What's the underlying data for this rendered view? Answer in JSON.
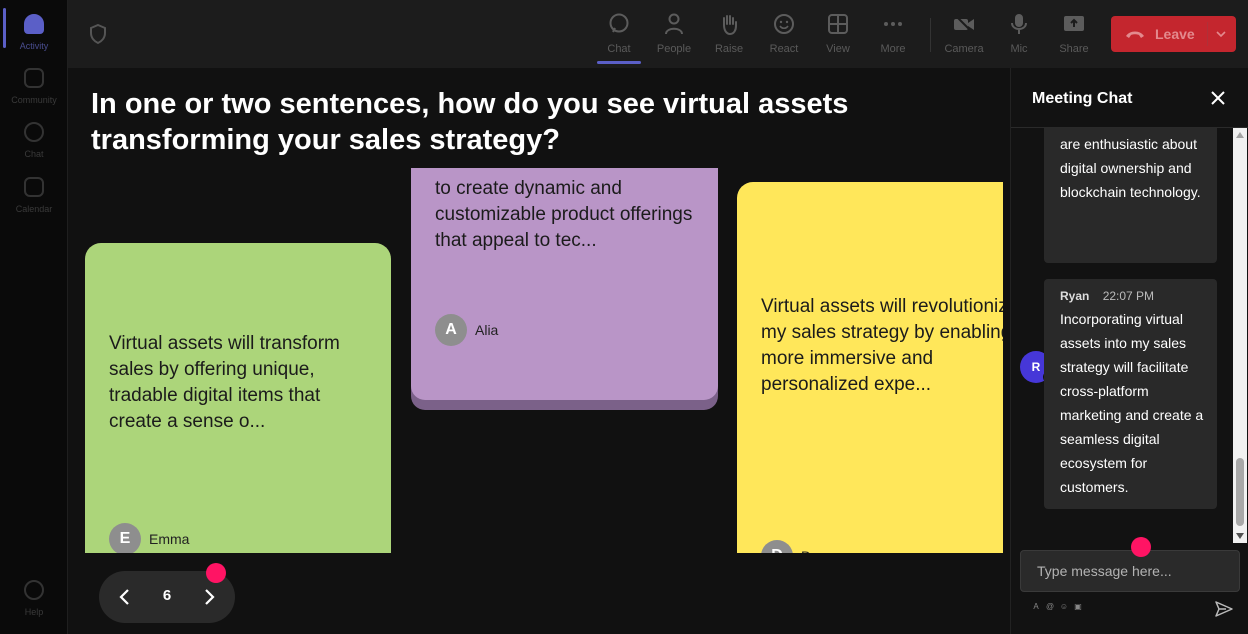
{
  "rail": {
    "items": [
      {
        "label": "Activity",
        "icon": "bell-icon"
      },
      {
        "label": "Community",
        "icon": "community-icon"
      },
      {
        "label": "Chat",
        "icon": "chat-icon"
      },
      {
        "label": "Calendar",
        "icon": "calendar-icon"
      }
    ],
    "help": "Help"
  },
  "toolbar": {
    "buttons": [
      {
        "label": "Chat",
        "icon": "chat-icon"
      },
      {
        "label": "People",
        "icon": "people-icon"
      },
      {
        "label": "Raise",
        "icon": "hand-icon"
      },
      {
        "label": "React",
        "icon": "emoji-icon"
      },
      {
        "label": "View",
        "icon": "grid-icon"
      },
      {
        "label": "More",
        "icon": "more-icon"
      },
      {
        "label": "Camera",
        "icon": "camera-off-icon"
      },
      {
        "label": "Mic",
        "icon": "mic-icon"
      },
      {
        "label": "Share",
        "icon": "share-icon"
      }
    ],
    "leave_label": "Leave"
  },
  "question": "In one or two sentences, how do you see virtual assets transforming your sales strategy?",
  "notes": [
    {
      "text": "Virtual assets will transform sales by offering unique, tradable digital items that create a sense o...",
      "author": "Emma",
      "initial": "E"
    },
    {
      "text": "to create dynamic and customizable product offerings that appeal to tec...",
      "author": "Alia",
      "initial": "A"
    },
    {
      "text": "Virtual assets will revolutionize my sales strategy by enabling more immersive and personalized expe...",
      "author": "D",
      "initial": "D"
    }
  ],
  "pager": {
    "page": "6"
  },
  "chat": {
    "title": "Meeting Chat",
    "messages": [
      {
        "text": "are enthusiastic about digital ownership and blockchain technology."
      },
      {
        "name": "Ryan",
        "time": "22:07 PM",
        "initial": "R",
        "text": "Incorporating virtual assets into my sales strategy will facilitate cross-platform marketing and create a seamless digital ecosystem for customers."
      }
    ],
    "input_placeholder": "Type message here..."
  },
  "colors": {
    "accent": "#5b5fc7",
    "leave": "#c4262e",
    "note_green": "#acd57a",
    "note_purple": "#b995c7",
    "note_yellow": "#ffe75a",
    "marker": "#ff1464"
  }
}
